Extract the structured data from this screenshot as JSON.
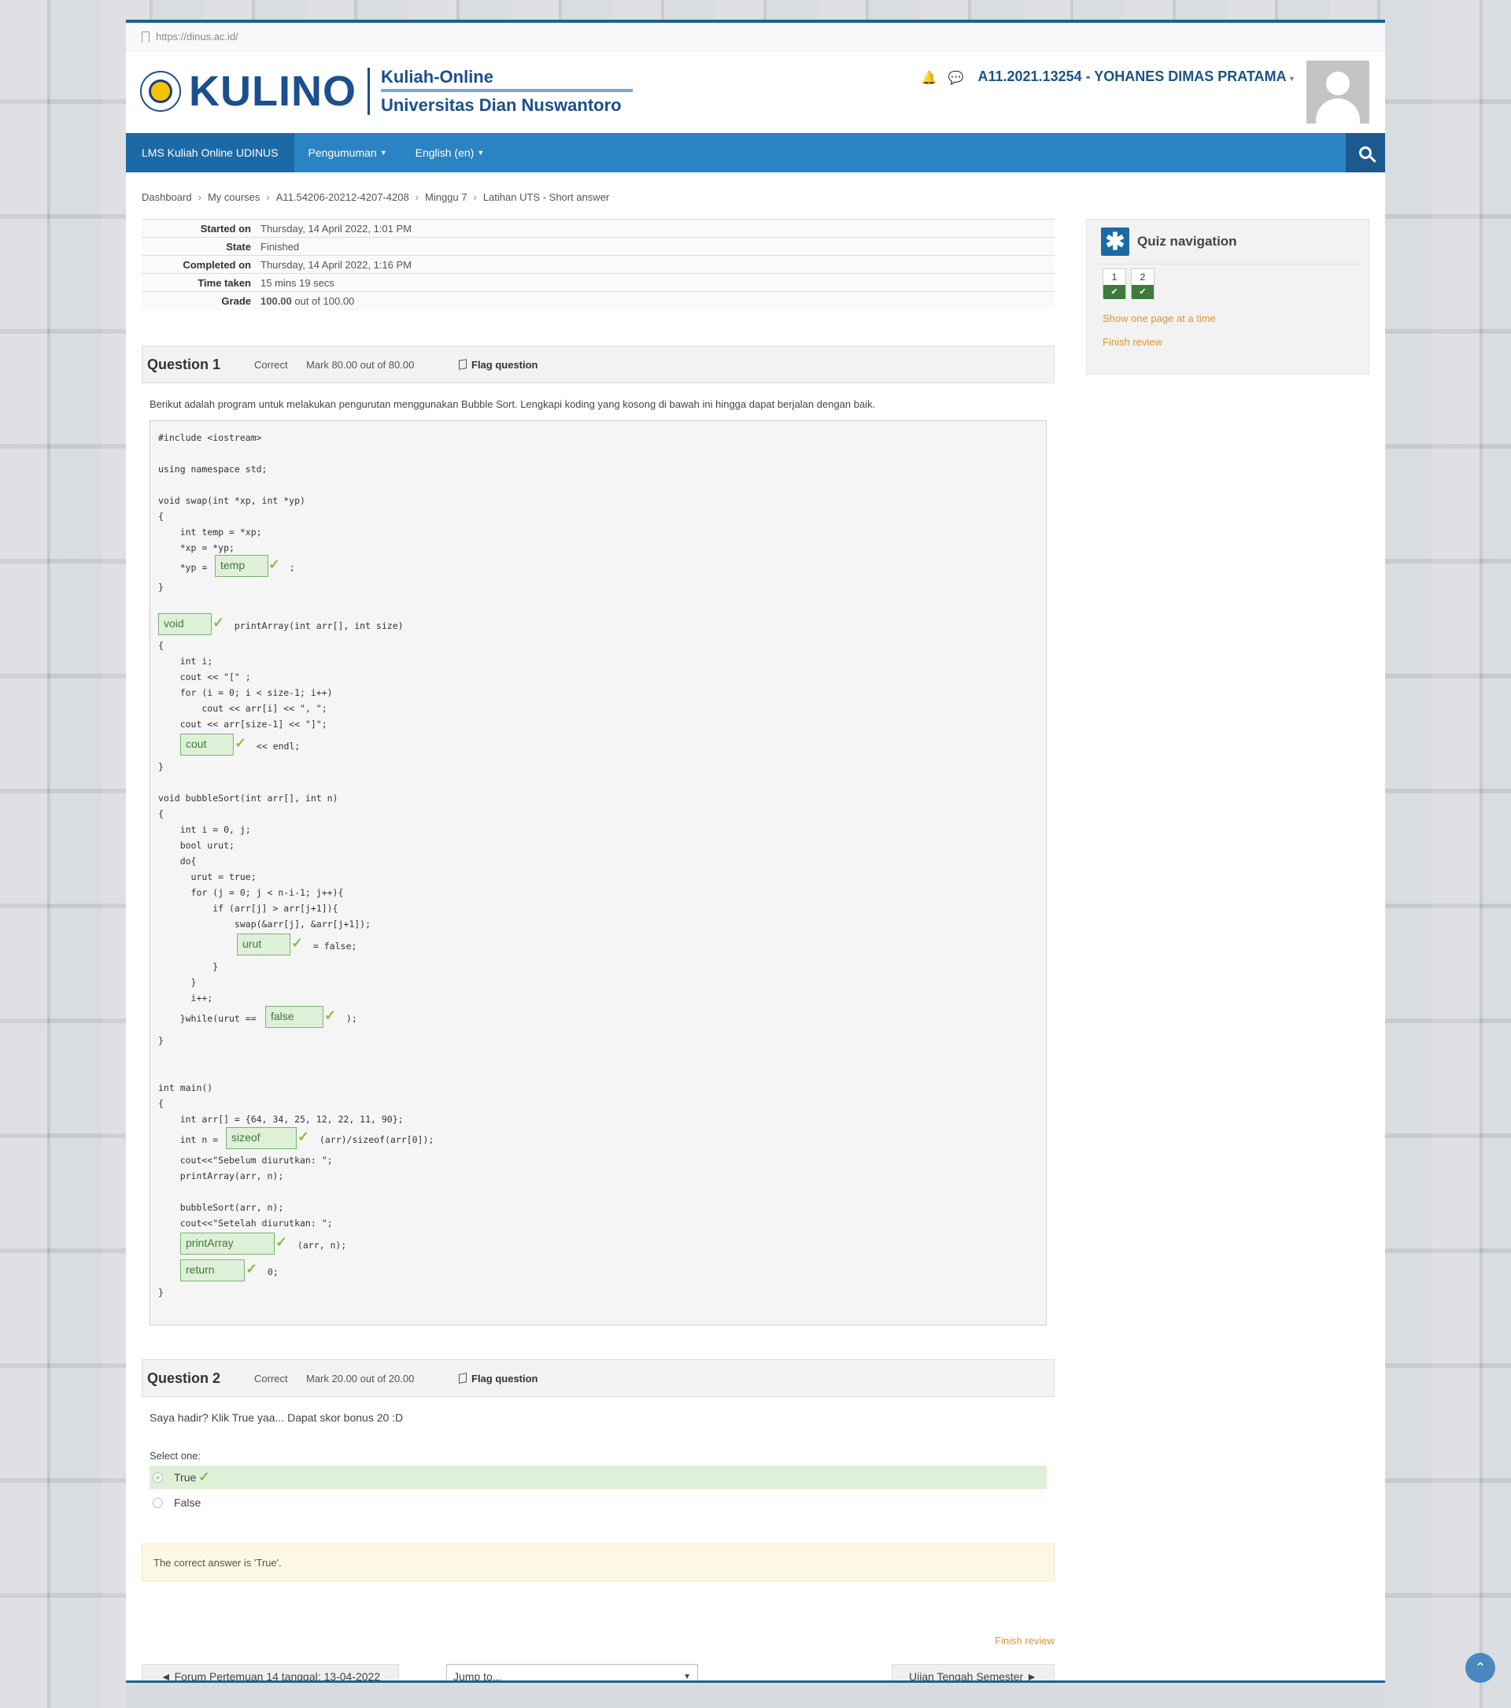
{
  "browser": {
    "url": "https://dinus.ac.id/"
  },
  "header": {
    "brand": "KULINO",
    "subtitle1": "Kuliah-Online",
    "subtitle2": "Universitas Dian Nuswantoro",
    "user": "A11.2021.13254 - YOHANES DIMAS PRATAMA"
  },
  "nav": {
    "home": "LMS Kuliah Online UDINUS",
    "items": [
      "Pengumuman",
      "English (en)"
    ]
  },
  "breadcrumb": [
    "Dashboard",
    "My courses",
    "A11.54206-20212-4207-4208",
    "Minggu 7",
    "Latihan UTS - Short answer"
  ],
  "summary": [
    {
      "k": "Started on",
      "v": "Thursday, 14 April 2022, 1:01 PM"
    },
    {
      "k": "State",
      "v": "Finished"
    },
    {
      "k": "Completed on",
      "v": "Thursday, 14 April 2022, 1:16 PM"
    },
    {
      "k": "Time taken",
      "v": "15 mins 19 secs"
    },
    {
      "k": "Grade",
      "v_bold": "100.00",
      "v": " out of 100.00"
    }
  ],
  "q1": {
    "title": "Question 1",
    "state": "Correct",
    "mark": "Mark 80.00 out of 80.00",
    "flag": "Flag question",
    "text": "Berikut adalah program untuk melakukan pengurutan menggunakan Bubble Sort. Lengkapi koding yang kosong di bawah ini hingga dapat berjalan dengan baik.",
    "code": {
      "l1": "#include <iostream>",
      "l2": "using namespace std;",
      "l3": "void swap(int *xp, int *yp)",
      "l4": "{",
      "l5": "    int temp = *xp;",
      "l6": "    *xp = *yp;",
      "l7": "    *yp = ",
      "l7b": " ;",
      "l8": "}",
      "l9b": " printArray(int arr[], int size)",
      "l10": "{",
      "l11": "    int i;",
      "l12": "    cout << \"[\" ;",
      "l13": "    for (i = 0; i < size-1; i++)",
      "l14": "        cout << arr[i] << \", \";",
      "l15": "    cout << arr[size-1] << \"]\";",
      "l16b": " << endl;",
      "l17": "}",
      "l18": "void bubbleSort(int arr[], int n)",
      "l19": "{",
      "l20": "    int i = 0, j;",
      "l21": "    bool urut;",
      "l22": "    do{",
      "l23": "      urut = true;",
      "l24": "      for (j = 0; j < n-i-1; j++){",
      "l25": "          if (arr[j] > arr[j+1]){",
      "l26": "              swap(&arr[j], &arr[j+1]);",
      "l27b": " = false;",
      "l28": "          }",
      "l29": "      }",
      "l30": "      i++;",
      "l31": "    }while(urut ==",
      "l31b": " );",
      "l32": "}",
      "l33": "int main()",
      "l34": "{",
      "l35": "    int arr[] = {64, 34, 25, 12, 22, 11, 90};",
      "l36": "    int n =",
      "l36b": " (arr)/sizeof(arr[0]);",
      "l37": "    cout<<\"Sebelum diurutkan: \";",
      "l38": "    printArray(arr, n);",
      "l39": "    bubbleSort(arr, n);",
      "l40": "    cout<<\"Setelah diurutkan: \";",
      "l41b": " (arr, n);",
      "l42b": " 0;",
      "l43": "}"
    },
    "answers": [
      "temp",
      "void",
      "cout",
      "urut",
      "false",
      "sizeof",
      "printArray",
      "return"
    ]
  },
  "q2": {
    "title": "Question 2",
    "state": "Correct",
    "mark": "Mark 20.00 out of 20.00",
    "flag": "Flag question",
    "text": "Saya hadir? Klik True yaa... Dapat skor bonus 20 :D",
    "select_label": "Select one:",
    "options": [
      "True",
      "False"
    ],
    "feedback": "The correct answer is 'True'."
  },
  "quiz_nav": {
    "title": "Quiz navigation",
    "questions": [
      "1",
      "2"
    ],
    "show_one": "Show one page at a time",
    "finish": "Finish review"
  },
  "footer": {
    "finish": "Finish review",
    "prev": "◄ Forum Pertemuan 14 tanggal: 13-04-2022",
    "jump": "Jump to...",
    "next": "Ujian Tengah Semester ►"
  }
}
